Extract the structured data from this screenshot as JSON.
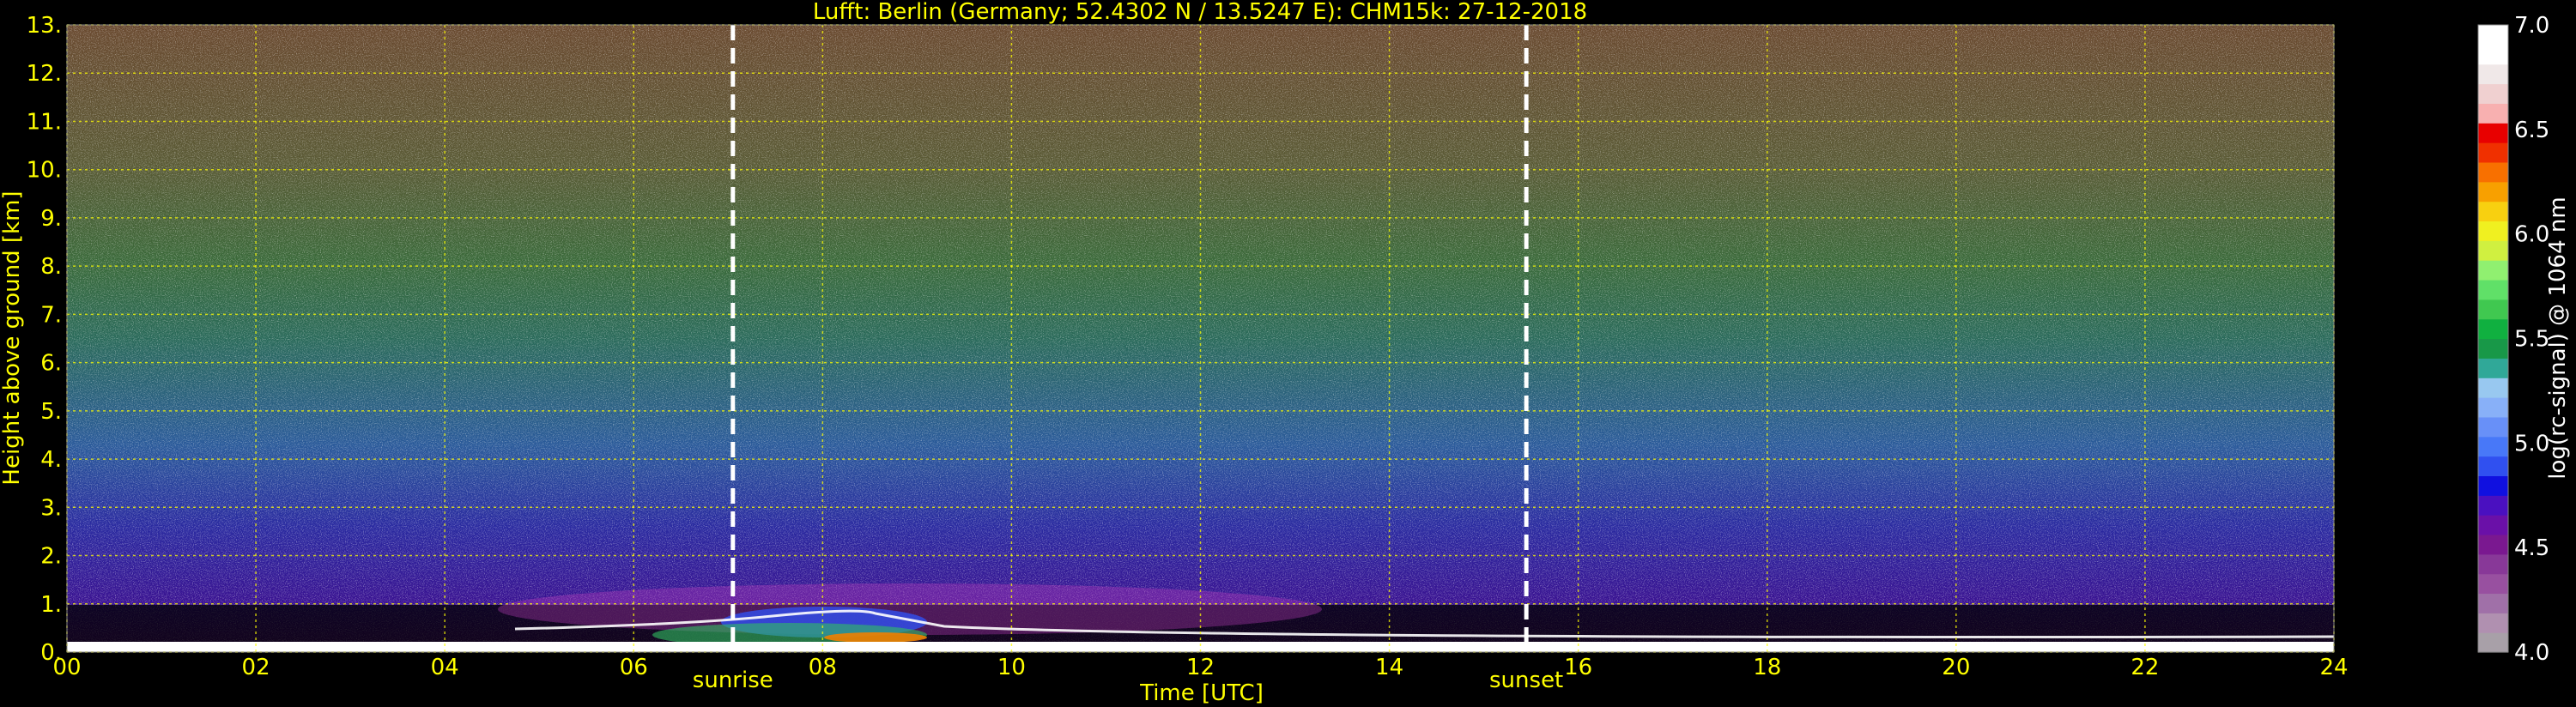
{
  "chart_data": {
    "type": "heatmap",
    "title": "Lufft: Berlin (Germany; 52.4302 N / 13.5247 E):    CHM15k: 27-12-2018",
    "xlabel": "Time [UTC]",
    "ylabel": "Height above ground [km]",
    "xlim": [
      0,
      24
    ],
    "ylim": [
      0,
      13
    ],
    "x_ticks": [
      "00",
      "02",
      "04",
      "06",
      "08",
      "10",
      "12",
      "14",
      "16",
      "18",
      "20",
      "22",
      "24"
    ],
    "y_ticks": [
      "0.",
      "1.",
      "2.",
      "3.",
      "4.",
      "5.",
      "6.",
      "7.",
      "8.",
      "9.",
      "10.",
      "11.",
      "12.",
      "13."
    ],
    "grid": true,
    "events": [
      {
        "label": "sunrise",
        "time": 7.05
      },
      {
        "label": "sunset",
        "time": 15.45
      }
    ],
    "colorbar": {
      "label": "log(rc-signal) @ 1064 nm",
      "range": [
        4.0,
        7.0
      ],
      "ticks": [
        "4.0",
        "4.5",
        "5.0",
        "5.5",
        "6.0",
        "6.5",
        "7.0"
      ],
      "colors": [
        "#a8a0a8",
        "#b090b0",
        "#a070a8",
        "#9850a0",
        "#883898",
        "#7a1890",
        "#6a10a8",
        "#4a10c0",
        "#1010e0",
        "#3050f0",
        "#4878f8",
        "#6890f8",
        "#88b0f8",
        "#98c8f0",
        "#30a898",
        "#189848",
        "#10b040",
        "#40c850",
        "#60e068",
        "#90f070",
        "#d0f040",
        "#f0f020",
        "#f8d010",
        "#f8a000",
        "#f87000",
        "#f03000",
        "#e80000",
        "#f8b0b0",
        "#f0d0d0",
        "#f0e8e8",
        "#ffffff",
        "#ffffff"
      ]
    }
  }
}
